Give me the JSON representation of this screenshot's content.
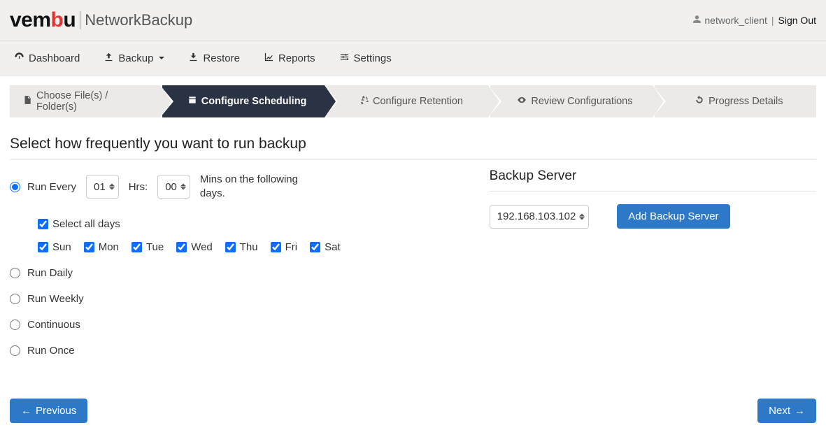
{
  "header": {
    "logo_parts": {
      "vem": "vem",
      "b": "b",
      "u": "u"
    },
    "product": "NetworkBackup",
    "username": "network_client",
    "signout": "Sign Out"
  },
  "nav": {
    "dashboard": "Dashboard",
    "backup": "Backup",
    "restore": "Restore",
    "reports": "Reports",
    "settings": "Settings"
  },
  "steps": {
    "choose": "Choose File(s) / Folder(s)",
    "schedule": "Configure Scheduling",
    "retention": "Configure Retention",
    "review": "Review Configurations",
    "progress": "Progress Details"
  },
  "page": {
    "title": "Select how frequently you want to run backup"
  },
  "schedule": {
    "run_every": "Run Every",
    "hours_value": "01",
    "hrs_label": "Hrs:",
    "mins_value": "00",
    "mins_text": "Mins on the following days.",
    "select_all": "Select all days",
    "days": {
      "sun": "Sun",
      "mon": "Mon",
      "tue": "Tue",
      "wed": "Wed",
      "thu": "Thu",
      "fri": "Fri",
      "sat": "Sat"
    },
    "run_daily": "Run Daily",
    "run_weekly": "Run Weekly",
    "continuous": "Continuous",
    "run_once": "Run Once"
  },
  "backup_server": {
    "title": "Backup Server",
    "selected": "192.168.103.102",
    "add_button": "Add Backup Server"
  },
  "footer": {
    "previous": "Previous",
    "next": "Next"
  }
}
